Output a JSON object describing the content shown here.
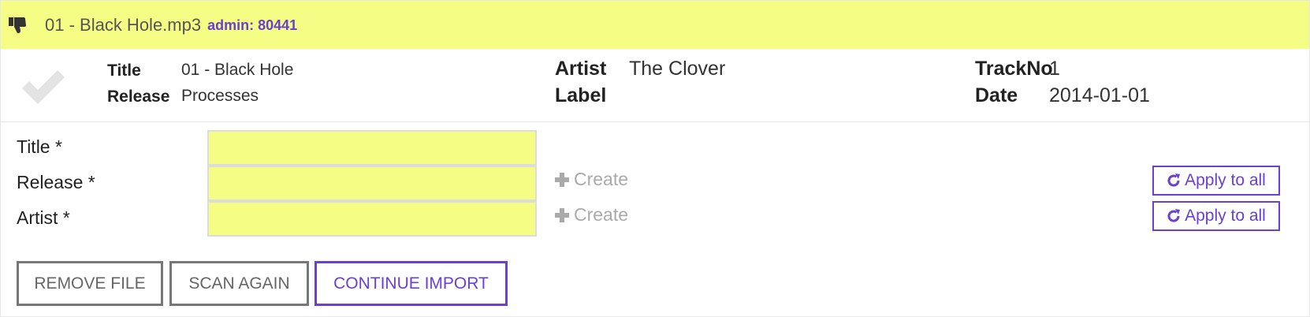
{
  "header": {
    "filename": "01 - Black Hole.mp3",
    "owner": "admin: 80441",
    "icon": "thumbs-down-icon",
    "background": "#f5fd84"
  },
  "metadata": {
    "icon": "check-icon",
    "title_key": "Title",
    "title_value": "01 - Black Hole",
    "release_key": "Release",
    "release_value": "Processes",
    "artist_key": "Artist",
    "artist_value": "The Clover",
    "label_key": "Label",
    "label_value": "",
    "trackno_key": "TrackNo",
    "trackno_value": "1",
    "date_key": "Date",
    "date_value": "2014-01-01"
  },
  "form": {
    "title_label": "Title *",
    "title_value": "",
    "release_label": "Release *",
    "release_value": "",
    "artist_label": "Artist *",
    "artist_value": "",
    "create_label": "Create",
    "apply_label": "Apply to all"
  },
  "actions": {
    "remove_label": "REMOVE FILE",
    "scan_label": "SCAN AGAIN",
    "continue_label": "CONTINUE IMPORT"
  },
  "colors": {
    "accent": "#6a3fd4",
    "highlight": "#f5fd84",
    "muted": "#aaaaaa"
  }
}
